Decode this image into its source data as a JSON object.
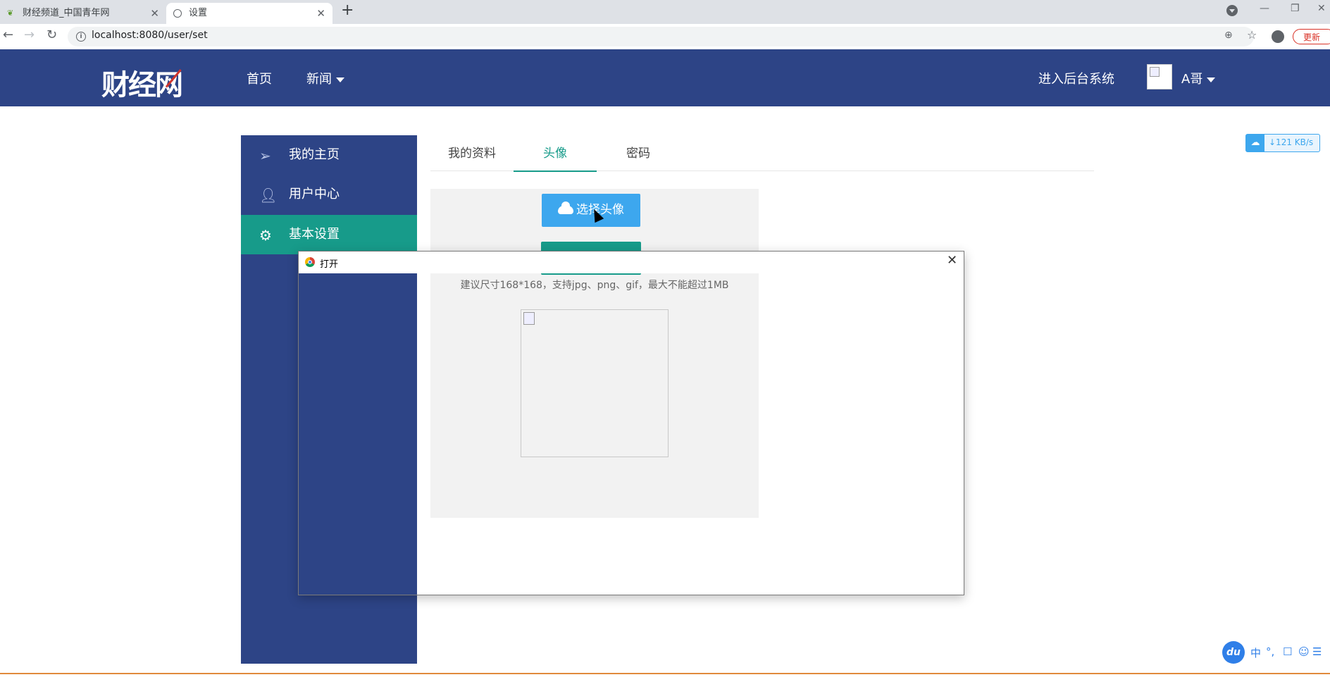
{
  "browser": {
    "tabs": [
      {
        "title": "财经频道_中国青年网",
        "active": false
      },
      {
        "title": "设置",
        "active": true
      }
    ],
    "url": "localhost:8080/user/set",
    "update_label": "更新"
  },
  "header": {
    "logo": "财经网",
    "nav": [
      {
        "label": "首页"
      },
      {
        "label": "新闻",
        "has_dropdown": true
      }
    ],
    "admin_link": "进入后台系统",
    "user_name": "A哥"
  },
  "sidebar": {
    "items": [
      {
        "label": "我的主页",
        "icon": "paper-plane-icon",
        "active": false
      },
      {
        "label": "用户中心",
        "icon": "user-icon",
        "active": false
      },
      {
        "label": "基本设置",
        "icon": "gear-icon",
        "active": true
      }
    ]
  },
  "tabs": [
    {
      "label": "我的资料",
      "active": false
    },
    {
      "label": "头像",
      "active": true
    },
    {
      "label": "密码",
      "active": false
    }
  ],
  "avatar_panel": {
    "upload_label": "选择头像",
    "hint": "建议尺寸168*168，支持jpg、png、gif，最大不能超过1MB"
  },
  "dialog": {
    "title": "打开"
  },
  "speed_widget": {
    "text": "↓121 KB/s"
  },
  "ime": {
    "logo": "du",
    "items": [
      "中",
      "°,",
      "☐",
      "☺",
      "☰"
    ]
  },
  "colors": {
    "brand_navy": "#2d4486",
    "accent_teal": "#179b8a",
    "button_blue": "#3da7ee"
  }
}
